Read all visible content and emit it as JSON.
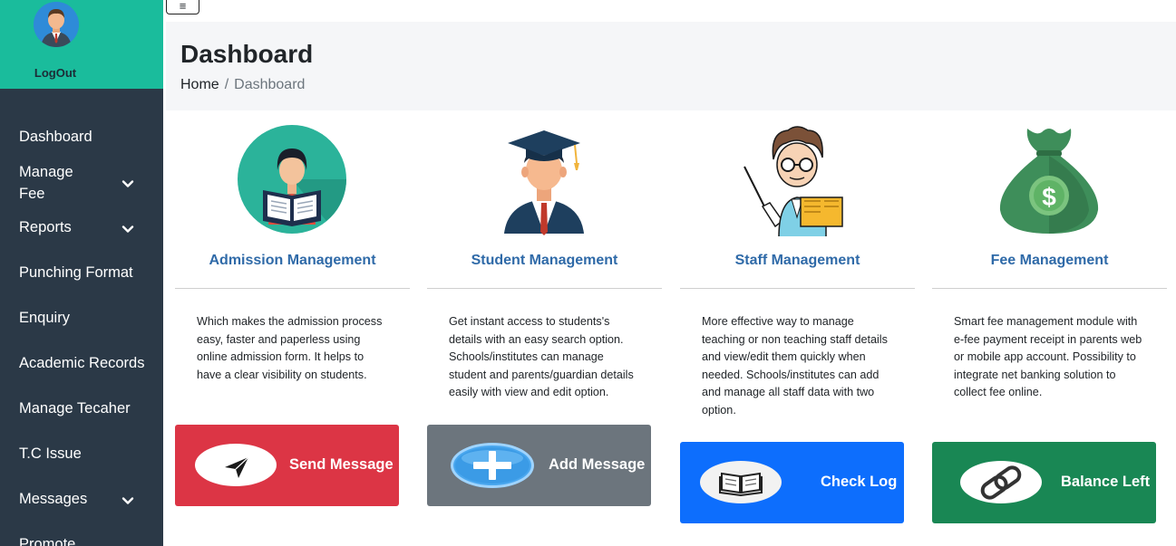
{
  "sidebar": {
    "logout_label": "LogOut",
    "items": [
      {
        "label": "Dashboard"
      },
      {
        "label": "Manage Fee"
      },
      {
        "label": "Reports"
      },
      {
        "label": "Punching Format"
      },
      {
        "label": "Enquiry"
      },
      {
        "label": "Academic Records"
      },
      {
        "label": "Manage Tecaher"
      },
      {
        "label": "T.C Issue"
      },
      {
        "label": "Messages"
      },
      {
        "label": "Promote"
      }
    ]
  },
  "toggle_icon": "≡",
  "header": {
    "title": "Dashboard",
    "breadcrumb": {
      "home": "Home",
      "separator": "/",
      "current": "Dashboard"
    }
  },
  "cards": [
    {
      "title": "Admission Management",
      "description": "Which makes the admission process easy, faster and paperless using online admission form. It helps to have a clear visibility on students.",
      "button_label": "Send Message",
      "button_color": "#dc3545",
      "button_icon": "send-icon"
    },
    {
      "title": "Student Management",
      "description": "Get instant access to students's details with an easy search option. Schools/institutes can manage student and parents/guardian details easily with view and edit option.",
      "button_label": "Add Message",
      "button_color": "#6c757d",
      "button_icon": "plus-icon"
    },
    {
      "title": "Staff Management",
      "description": "More effective way to manage teaching or non teaching staff details and view/edit them quickly when needed. Schools/institutes can add and manage all staff data with two option.",
      "button_label": "Check Log",
      "button_color": "#0d6efd",
      "button_icon": "book-icon"
    },
    {
      "title": "Fee Management",
      "description": "Smart fee management module with e-fee payment receipt in parents web or mobile app account. Possibility to integrate net banking solution to collect fee online.",
      "button_label": "Balance Left",
      "button_color": "#198754",
      "button_icon": "chain-link-icon"
    }
  ],
  "colors": {
    "sidebar_bg": "#2b3947",
    "profile_bg": "#1abc9c",
    "header_bg": "#f5f6f8",
    "card_title": "#2f6aa8"
  }
}
